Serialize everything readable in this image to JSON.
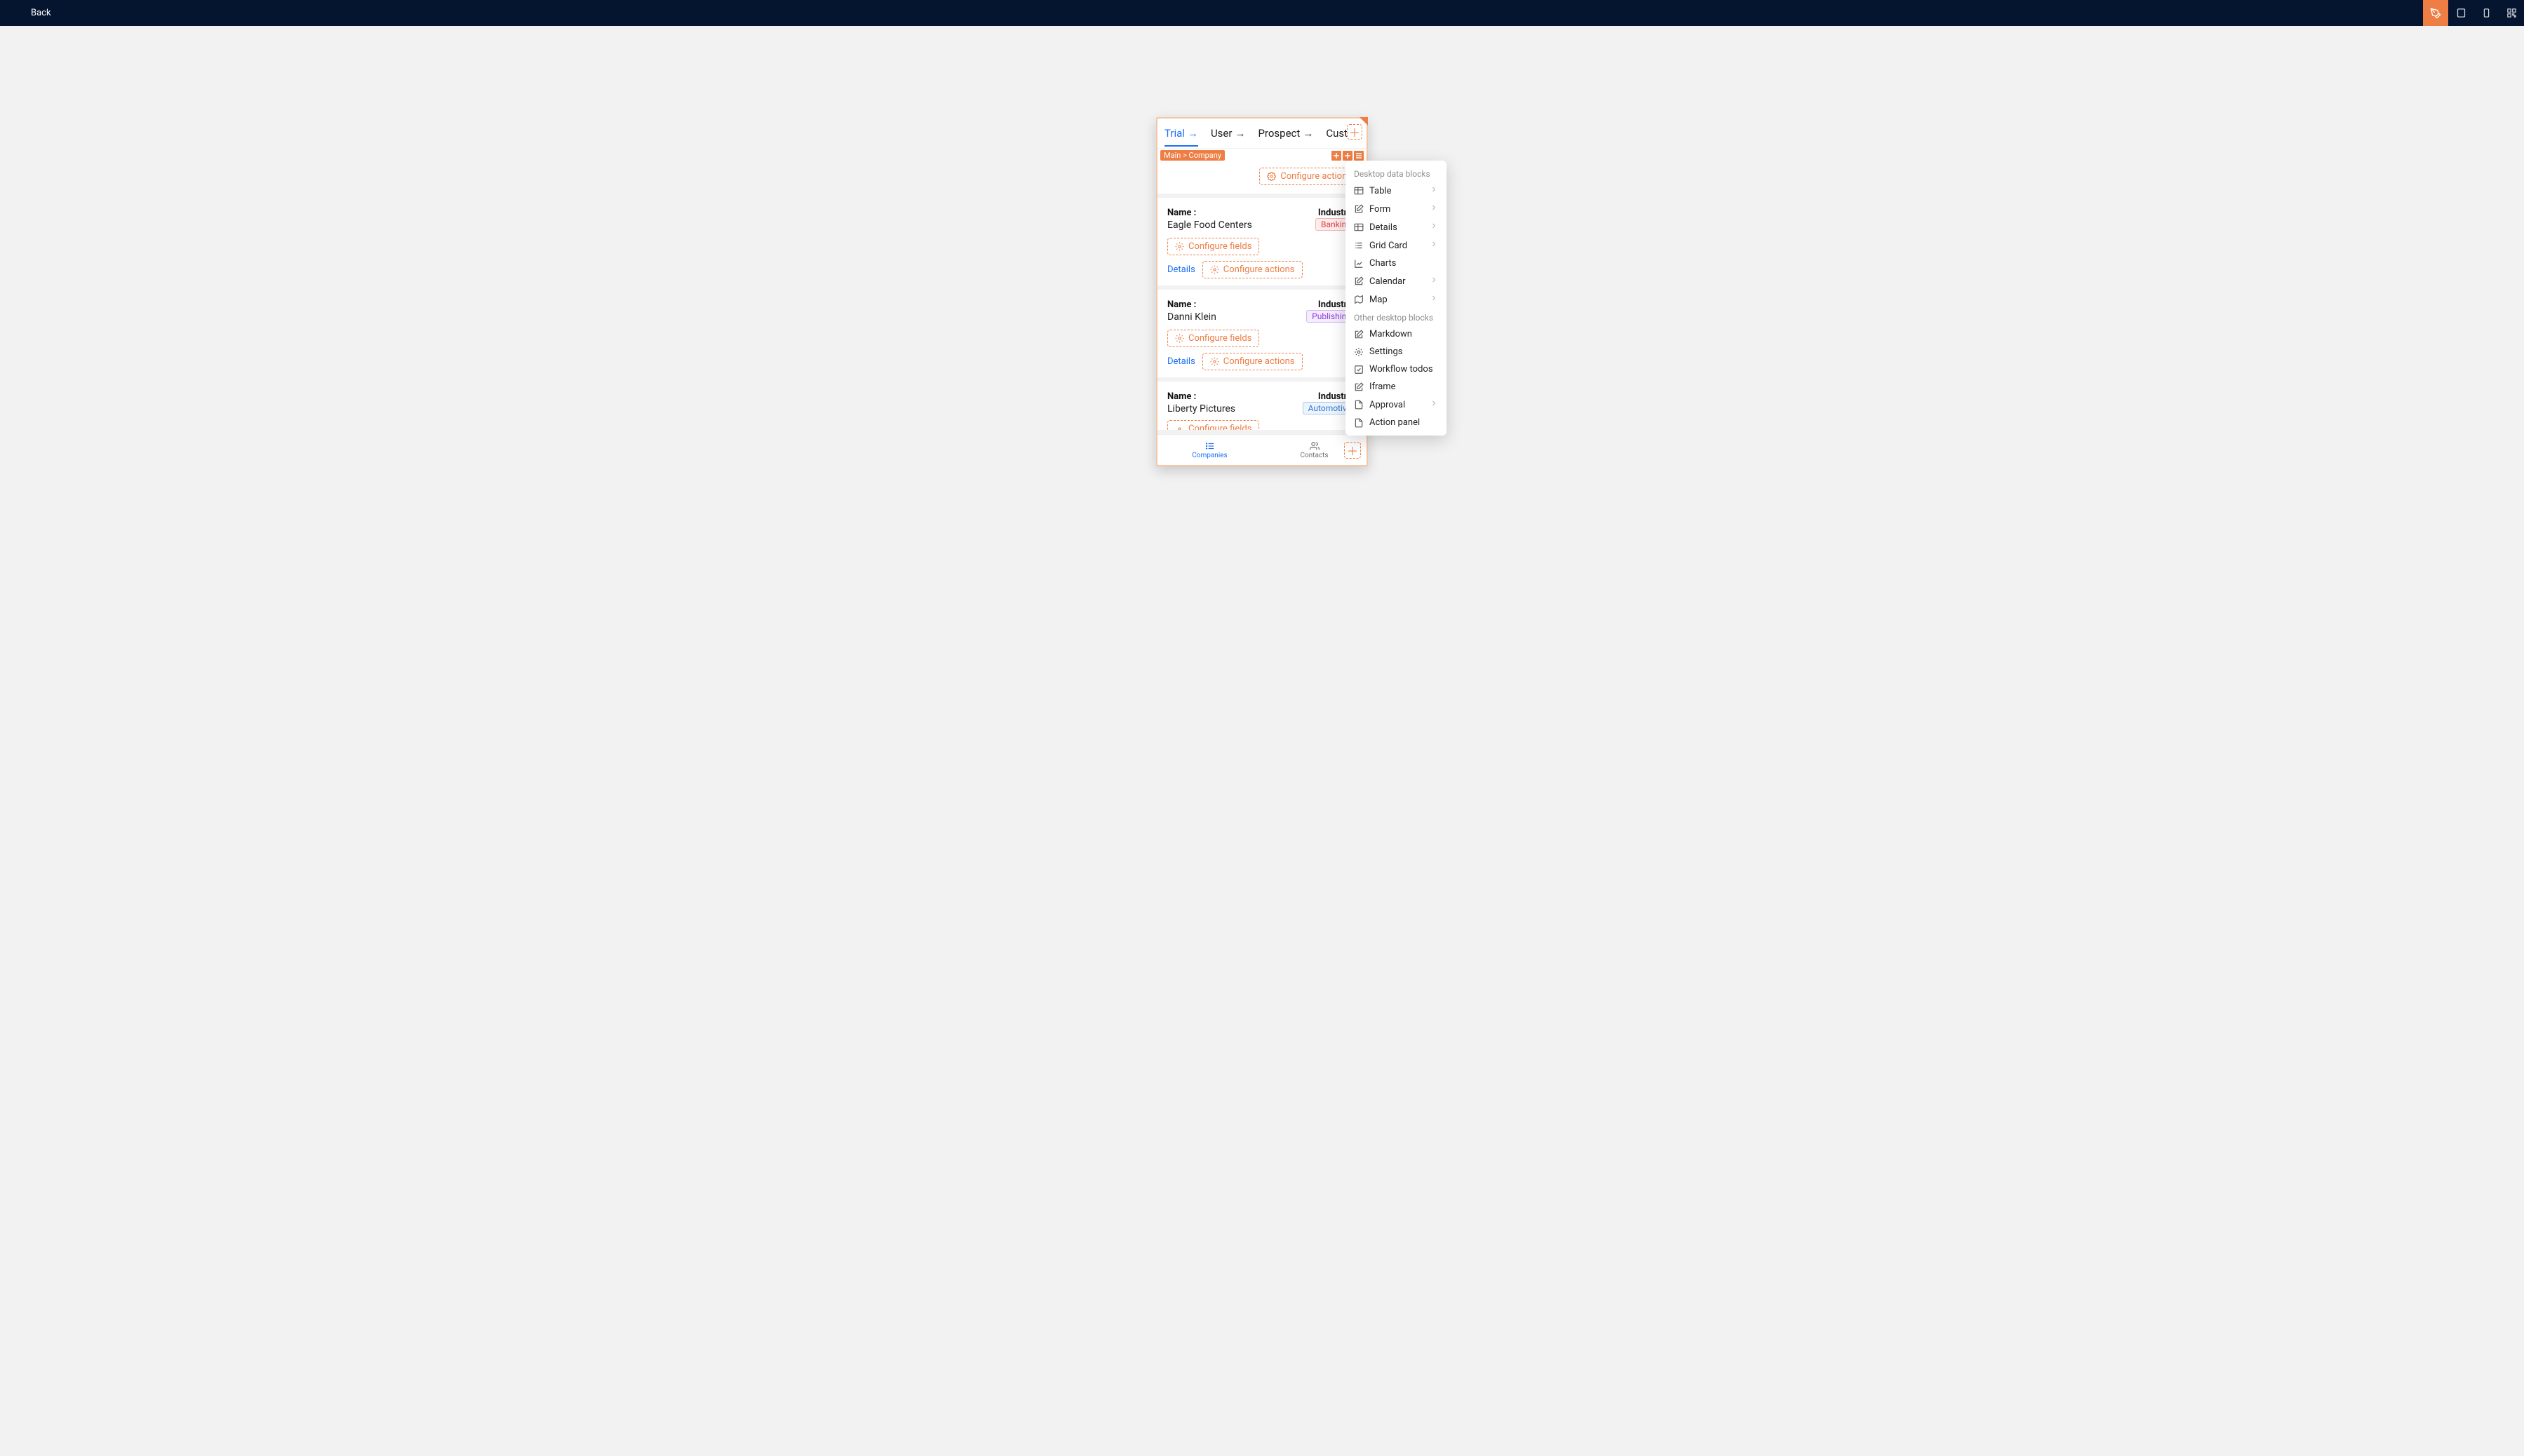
{
  "topbar": {
    "back_label": "Back"
  },
  "tabs": [
    {
      "label": "Trial",
      "active": true
    },
    {
      "label": "User",
      "active": false
    },
    {
      "label": "Prospect",
      "active": false
    },
    {
      "label": "Customer",
      "active": false
    }
  ],
  "breadcrumb": "Main > Company",
  "config": {
    "configure_actions": "Configure actions",
    "configure_fields": "Configure fields"
  },
  "card_labels": {
    "name": "Name :",
    "industry": "Industry :",
    "details": "Details"
  },
  "cards": [
    {
      "name": "Eagle Food Centers",
      "industry": "Banking",
      "industry_class": "banking"
    },
    {
      "name": "Danni Klein",
      "industry": "Publishing",
      "industry_class": "publishing"
    },
    {
      "name": "Liberty Pictures",
      "industry": "Automotive",
      "industry_class": "automotive"
    }
  ],
  "bottom_nav": {
    "companies": "Companies",
    "contacts": "Contacts"
  },
  "popover": {
    "section1_title": "Desktop data blocks",
    "section1": [
      {
        "label": "Table",
        "sub": true,
        "icon": "grid"
      },
      {
        "label": "Form",
        "sub": true,
        "icon": "edit"
      },
      {
        "label": "Details",
        "sub": true,
        "icon": "grid"
      },
      {
        "label": "Grid Card",
        "sub": true,
        "icon": "list"
      },
      {
        "label": "Charts",
        "sub": false,
        "icon": "chart"
      },
      {
        "label": "Calendar",
        "sub": true,
        "icon": "edit"
      },
      {
        "label": "Map",
        "sub": true,
        "icon": "map"
      }
    ],
    "section2_title": "Other desktop blocks",
    "section2": [
      {
        "label": "Markdown",
        "sub": false,
        "icon": "edit"
      },
      {
        "label": "Settings",
        "sub": false,
        "icon": "gear"
      },
      {
        "label": "Workflow todos",
        "sub": false,
        "icon": "check"
      },
      {
        "label": "Iframe",
        "sub": false,
        "icon": "edit"
      },
      {
        "label": "Approval",
        "sub": true,
        "icon": "doc"
      },
      {
        "label": "Action panel",
        "sub": false,
        "icon": "doc"
      }
    ]
  }
}
